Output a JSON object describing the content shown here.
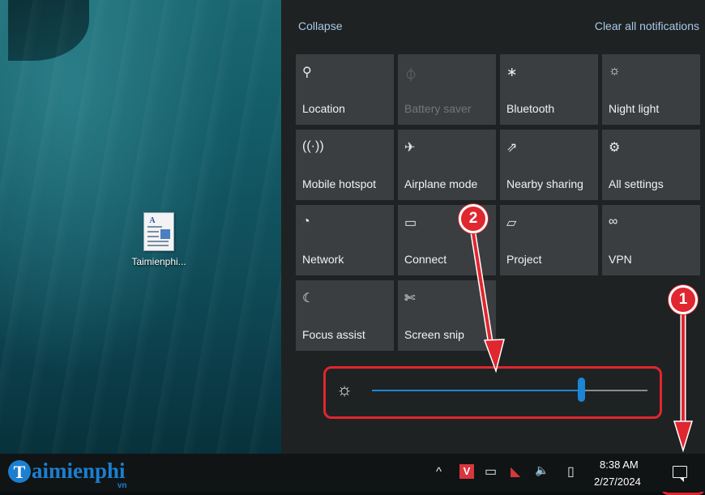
{
  "desktop": {
    "icon_label": "Taimienphi..."
  },
  "action_center": {
    "collapse_label": "Collapse",
    "clear_all_label": "Clear all notifications",
    "tiles": [
      {
        "label": "Location",
        "icon": "⚲",
        "icon_name": "location-icon",
        "disabled": false
      },
      {
        "label": "Battery saver",
        "icon": "⏀",
        "icon_name": "battery-saver-icon",
        "disabled": true
      },
      {
        "label": "Bluetooth",
        "icon": "∗",
        "icon_name": "bluetooth-icon",
        "disabled": false
      },
      {
        "label": "Night light",
        "icon": "☼",
        "icon_name": "night-light-icon",
        "disabled": false
      },
      {
        "label": "Mobile hotspot",
        "icon": "((·))",
        "icon_name": "mobile-hotspot-icon",
        "disabled": false
      },
      {
        "label": "Airplane mode",
        "icon": "✈",
        "icon_name": "airplane-icon",
        "disabled": false
      },
      {
        "label": "Nearby sharing",
        "icon": "⇗",
        "icon_name": "nearby-sharing-icon",
        "disabled": false
      },
      {
        "label": "All settings",
        "icon": "⚙",
        "icon_name": "gear-icon",
        "disabled": false
      },
      {
        "label": "Network",
        "icon": "◔",
        "icon_name": "network-icon",
        "disabled": false
      },
      {
        "label": "Connect",
        "icon": "▭",
        "icon_name": "connect-icon",
        "disabled": false
      },
      {
        "label": "Project",
        "icon": "▱",
        "icon_name": "project-icon",
        "disabled": false
      },
      {
        "label": "VPN",
        "icon": "∞",
        "icon_name": "vpn-icon",
        "disabled": false
      },
      {
        "label": "Focus assist",
        "icon": "☾",
        "icon_name": "moon-icon",
        "disabled": false
      },
      {
        "label": "Screen snip",
        "icon": "✄",
        "icon_name": "scissors-icon",
        "disabled": false
      }
    ],
    "brightness": {
      "icon": "☼",
      "level": 0.76
    }
  },
  "taskbar": {
    "brand_text": "aimienphi",
    "brand_initial": "T",
    "brand_suffix": "vn",
    "tray_chevron": "^",
    "tray_v": "V",
    "tray_battery": "▭",
    "tray_mark": "◣",
    "tray_volume": "🔈",
    "tray_network": "▯",
    "clock_time": "8:38 AM",
    "clock_date": "2/27/2024"
  },
  "annotations": {
    "badge_1": "1",
    "badge_2": "2"
  },
  "colors": {
    "accent": "#1b86d6",
    "annotation": "#e0262f",
    "tile": "#3b3e40",
    "panel": "#1f2223"
  }
}
